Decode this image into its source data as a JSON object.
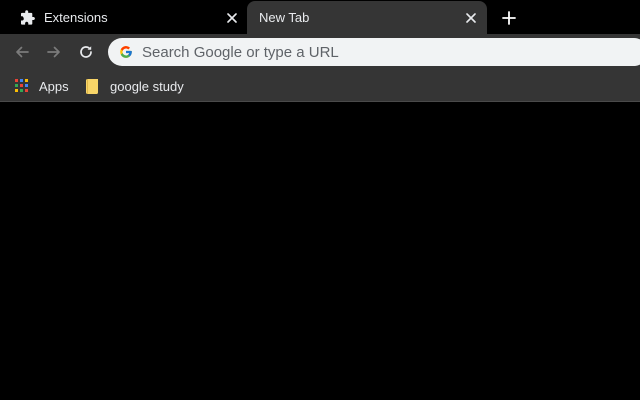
{
  "tabs": [
    {
      "title": "Extensions",
      "icon": "puzzle-icon",
      "active": false
    },
    {
      "title": "New Tab",
      "active": true
    }
  ],
  "toolbar": {
    "back_icon": "back-arrow-icon",
    "forward_icon": "forward-arrow-icon",
    "reload_icon": "reload-icon"
  },
  "omnibox": {
    "placeholder": "Search Google or type a URL",
    "value": "",
    "icon": "google-g-icon"
  },
  "bookmarks": [
    {
      "label": "Apps",
      "icon": "apps-grid-icon"
    },
    {
      "label": "google study",
      "icon": "folder-icon"
    }
  ],
  "colors": {
    "tabstrip": "#000000",
    "toolbar": "#353535",
    "content": "#000000",
    "folder": "#f8d568",
    "text": "#e8eaed"
  }
}
